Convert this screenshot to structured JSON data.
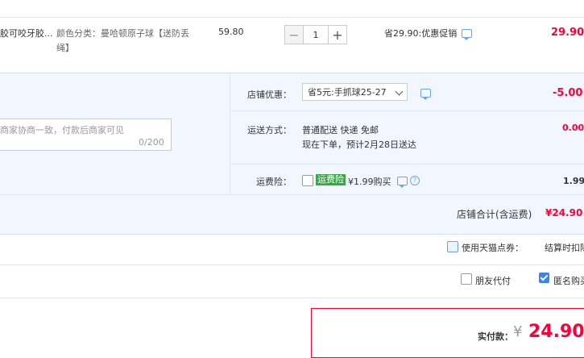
{
  "item": {
    "name": "胶可咬牙胶...",
    "spec": "颜色分类：曼哈顿原子球【送防丢绳】",
    "unit_price": "59.80",
    "quantity": "1",
    "qty_minus": "−",
    "qty_plus": "+",
    "promo": "省29.90:优惠促销",
    "subtotal": "29.90"
  },
  "store": {
    "discount_label": "店铺优惠：",
    "discount_selected": "省5元:手抓球25-27",
    "discount_value": "-5.00",
    "message_placeholder": "商家协商一致，付款后商家可见",
    "message_count": "0/200",
    "shipping_label": "运送方式：",
    "shipping_method": "普通配送 快递 免邮",
    "shipping_eta": "现在下单，预计2月28日送达",
    "shipping_value": "0.00",
    "insurance_label": "运费险：",
    "insurance_badge": "运费险",
    "insurance_price": "¥1.99购买",
    "insurance_help": "?",
    "insurance_value": "1.99",
    "total_label": "店铺合计(含运费)",
    "total_value": "¥24.90"
  },
  "options": {
    "tmall_points_label": "使用天猫点券：",
    "tmall_points_note": "结算时扣除",
    "friend_pay_label": "朋友代付",
    "anonymous_label": "匿名购买",
    "anonymous_checked": true
  },
  "payment": {
    "label": "实付款：",
    "currency": "¥",
    "amount": "24.90"
  },
  "colors": {
    "accent_red": "#ff0036",
    "panel_bg": "#f2f7ff",
    "insurance_green": "#3aa745",
    "checkbox_blue": "#3b82f6"
  },
  "icons": {
    "comment": "comment-icon",
    "help": "help-icon",
    "chevron": "chevron-down-icon"
  }
}
